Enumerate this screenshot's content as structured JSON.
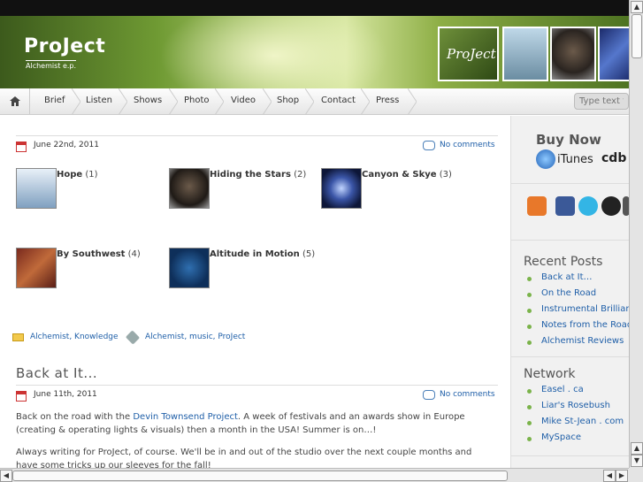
{
  "header": {
    "title": "ProJect",
    "subtitle": "Alchemist e.p.",
    "logo_thumb_text": "ProJect"
  },
  "nav": {
    "items": [
      "Brief",
      "Listen",
      "Shows",
      "Photo",
      "Video",
      "Shop",
      "Contact",
      "Press"
    ],
    "search_placeholder": "Type text to"
  },
  "post1": {
    "date": "June 22nd, 2011",
    "comments": "No comments",
    "gallery": [
      {
        "name": "Hope",
        "count": "(1)"
      },
      {
        "name": "Hiding the Stars",
        "count": "(2)"
      },
      {
        "name": "Canyon & Skye",
        "count": "(3)"
      },
      {
        "name": "By Southwest",
        "count": "(4)"
      },
      {
        "name": "Altitude in Motion",
        "count": "(5)"
      }
    ],
    "categories": "Alchemist, Knowledge",
    "tags": "Alchemist, music, ProJect"
  },
  "post2": {
    "title": "Back at It...",
    "date": "June 11th, 2011",
    "comments": "No comments",
    "para1_before": "Back on the road with the ",
    "para1_link": "Devin Townsend Project",
    "para1_after": ". A week of festivals and an awards show in Europe (creating & operating lights & visuals) then a month in the USA! Summer is on…!",
    "para2": "Always writing for ProJect, of course. We'll be in and out of the studio over the next couple months and have some tricks up our sleeves for the fall!"
  },
  "sidebar": {
    "buy_now": "Buy Now",
    "itunes": "iTunes",
    "cdbaby": "cdb",
    "recent_posts_title": "Recent Posts",
    "recent_posts": [
      "Back at It…",
      "On the Road",
      "Instrumental Brillianc",
      "Notes from the Road",
      "Alchemist Reviews"
    ],
    "network_title": "Network",
    "network": [
      "Easel . ca",
      "Liar's Rosebush",
      "Mike St-Jean . com",
      "MySpace"
    ]
  }
}
